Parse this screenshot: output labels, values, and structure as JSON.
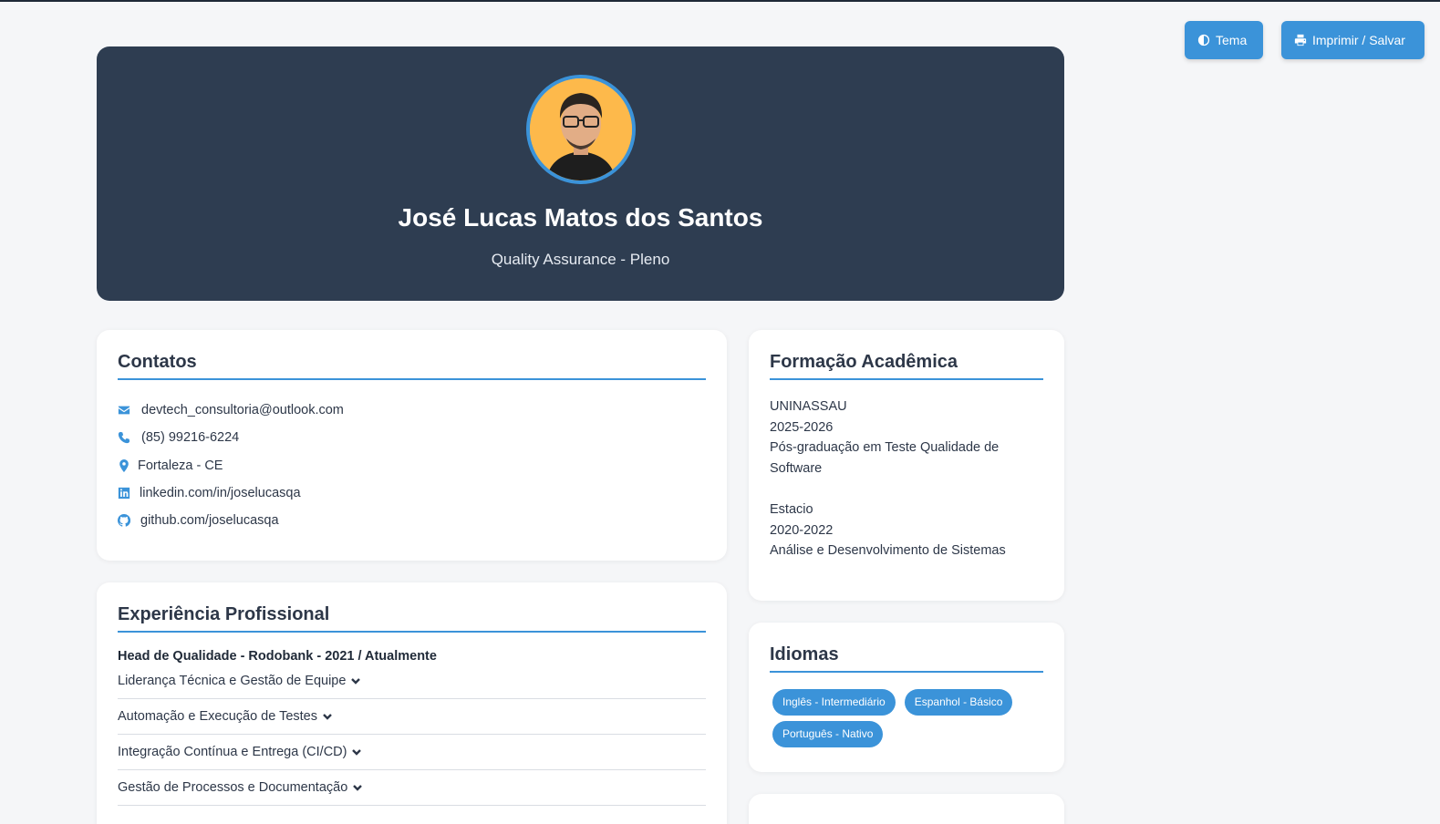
{
  "toolbar": {
    "theme_label": "Tema",
    "print_label": "Imprimir / Salvar"
  },
  "header": {
    "name": "José Lucas Matos dos Santos",
    "role": "Quality Assurance - Pleno"
  },
  "contacts": {
    "title": "Contatos",
    "items": [
      {
        "icon": "envelope-icon",
        "text": "devtech_consultoria@outlook.com"
      },
      {
        "icon": "phone-icon",
        "text": "(85) 99216-6224"
      },
      {
        "icon": "map-pin-icon",
        "text": "Fortaleza - CE"
      },
      {
        "icon": "linkedin-icon",
        "text": "linkedin.com/in/joselucasqa"
      },
      {
        "icon": "github-icon",
        "text": "github.com/joselucasqa"
      }
    ]
  },
  "education": {
    "title": "Formação Acadêmica",
    "entries": [
      {
        "school": "UNINASSAU",
        "period": "2025-2026",
        "course": "Pós-graduação em Teste Qualidade de Software"
      },
      {
        "school": "Estacio",
        "period": "2020-2022",
        "course": "Análise e Desenvolvimento de Sistemas"
      }
    ]
  },
  "languages": {
    "title": "Idiomas",
    "items": [
      "Inglês - Intermediário",
      "Espanhol - Básico",
      "Português - Nativo"
    ]
  },
  "experience": {
    "title": "Experiência Profissional",
    "job_title": "Head de Qualidade - Rodobank - 2021 / Atualmente",
    "sections": [
      "Liderança Técnica e Gestão de Equipe",
      "Automação e Execução de Testes",
      "Integração Contínua e Entrega (CI/CD)",
      "Gestão de Processos e Documentação"
    ]
  },
  "colors": {
    "accent": "#3b93d9",
    "header_bg": "#2e3d51",
    "page_bg": "#f5f6f8",
    "avatar_bg": "#fdb94b"
  }
}
